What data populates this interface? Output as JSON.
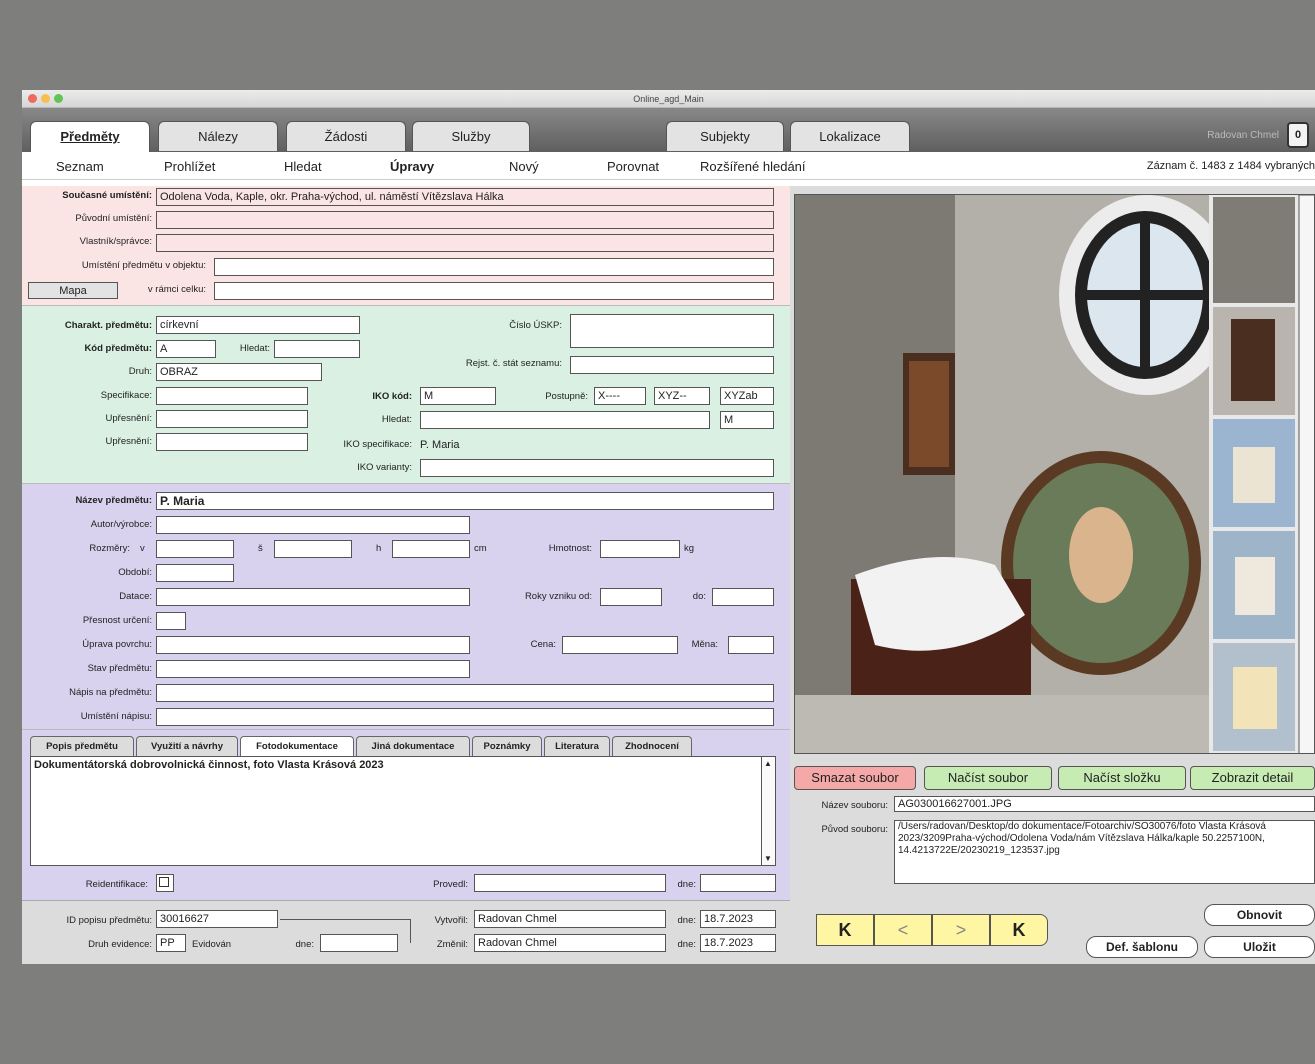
{
  "window": {
    "title": "Online_agd_Main",
    "user": "Radovan Chmel"
  },
  "tabs": [
    "Předměty",
    "Nálezy",
    "Žádosti",
    "Služby",
    "Subjekty",
    "Lokalizace"
  ],
  "menu": [
    "Seznam",
    "Prohlížet",
    "Hledat",
    "Úpravy",
    "Nový",
    "Porovnat",
    "Rozšířené hledání"
  ],
  "record_info": "Záznam č. 1483 z 1484 vybraných",
  "location": {
    "current_label": "Současné umístění:",
    "current_value": "Odolena Voda, Kaple, okr. Praha-východ, ul. náměstí Vítězslava Hálka",
    "original_label": "Původní umístění:",
    "owner_label": "Vlastník/správce:",
    "in_object_label": "Umístění předmětu v objektu:",
    "map_button": "Mapa",
    "in_whole_label": "v rámci celku:"
  },
  "character": {
    "charakt_label": "Charakt. předmětu:",
    "charakt_value": "církevní",
    "code_label": "Kód předmětu:",
    "code_value": "A",
    "hledat_label": "Hledat:",
    "druh_label": "Druh:",
    "druh_value": "OBRAZ",
    "spec_label": "Specifikace:",
    "upr1_label": "Upřesnění:",
    "upr2_label": "Upřesnění:",
    "uskp_label": "Číslo ÚSKP:",
    "rejst_label": "Rejst. č. stát seznamu:",
    "iko_label": "IKO kód:",
    "iko_value": "M",
    "postupne_label": "Postupně:",
    "p1": "X----",
    "p2": "XYZ--",
    "p3": "XYZab",
    "iko_hledat_label": "Hledat:",
    "iko_m": "M",
    "iko_spec_label": "IKO specifikace:",
    "iko_spec_value": "P. Maria",
    "iko_var_label": "IKO varianty:"
  },
  "object": {
    "name_label": "Název předmětu:",
    "name_value": "P. Maria",
    "author_label": "Autor/výrobce:",
    "dims_label": "Rozměry:",
    "v": "v",
    "s": "š",
    "h": "h",
    "cm": "cm",
    "weight_label": "Hmotnost:",
    "kg": "kg",
    "period_label": "Období:",
    "dating_label": "Datace:",
    "years_label": "Roky vzniku od:",
    "to_label": "do:",
    "accuracy_label": "Přesnost určení:",
    "surface_label": "Úprava povrchu:",
    "price_label": "Cena:",
    "currency_label": "Měna:",
    "state_label": "Stav předmětu:",
    "inscr_label": "Nápis na předmětu:",
    "inscr_loc_label": "Umístění nápisu:"
  },
  "subtabs": [
    "Popis předmětu",
    "Využití a návrhy",
    "Fotodokumentace",
    "Jiná dokumentace",
    "Poznámky",
    "Literatura",
    "Zhodnocení"
  ],
  "notes": "Dokumentátorská dobrovolnická činnost, foto Vlasta Krásová 2023",
  "reid": {
    "label": "Reidentifikace:",
    "provedl_label": "Provedl:",
    "dne_label": "dne:"
  },
  "footer": {
    "id_label": "ID popisu předmětu:",
    "id_value": "30016627",
    "druh_label": "Druh evidence:",
    "druh_value": "PP",
    "druh_text": "Evidován",
    "dne_label": "dne:",
    "created_label": "Vytvořil:",
    "created_value": "Radovan Chmel",
    "created_date": "18.7.2023",
    "changed_label": "Změnil:",
    "changed_value": "Radovan Chmel",
    "changed_date": "18.7.2023"
  },
  "actions": [
    "Smazat soubor",
    "Načíst soubor",
    "Načíst složku",
    "Zobrazit detail"
  ],
  "file": {
    "name_label": "Název souboru:",
    "name_value": "AG030016627001.JPG",
    "origin_label": "Původ souboru:",
    "origin_value": "/Users/radovan/Desktop/do dokumentace/Fotoarchiv/SO30076/foto Vlasta Krásová 2023/3209Praha-východ/Odolena Voda/nám Vítězslava Hálka/kaple 50.2257100N, 14.4213722E/20230219_123537.jpg"
  },
  "nav": [
    "K",
    "<",
    ">",
    "K"
  ],
  "buttons": {
    "refresh": "Obnovit",
    "template": "Def. šablonu",
    "save": "Uložit"
  },
  "colors": {
    "pink": "#fbe4e4",
    "green": "#d9f0e3",
    "purple": "#d8d2ee",
    "red_btn": "#f4a8a8",
    "green_btn": "#c6ecb4",
    "yellow": "#fef6a3"
  }
}
